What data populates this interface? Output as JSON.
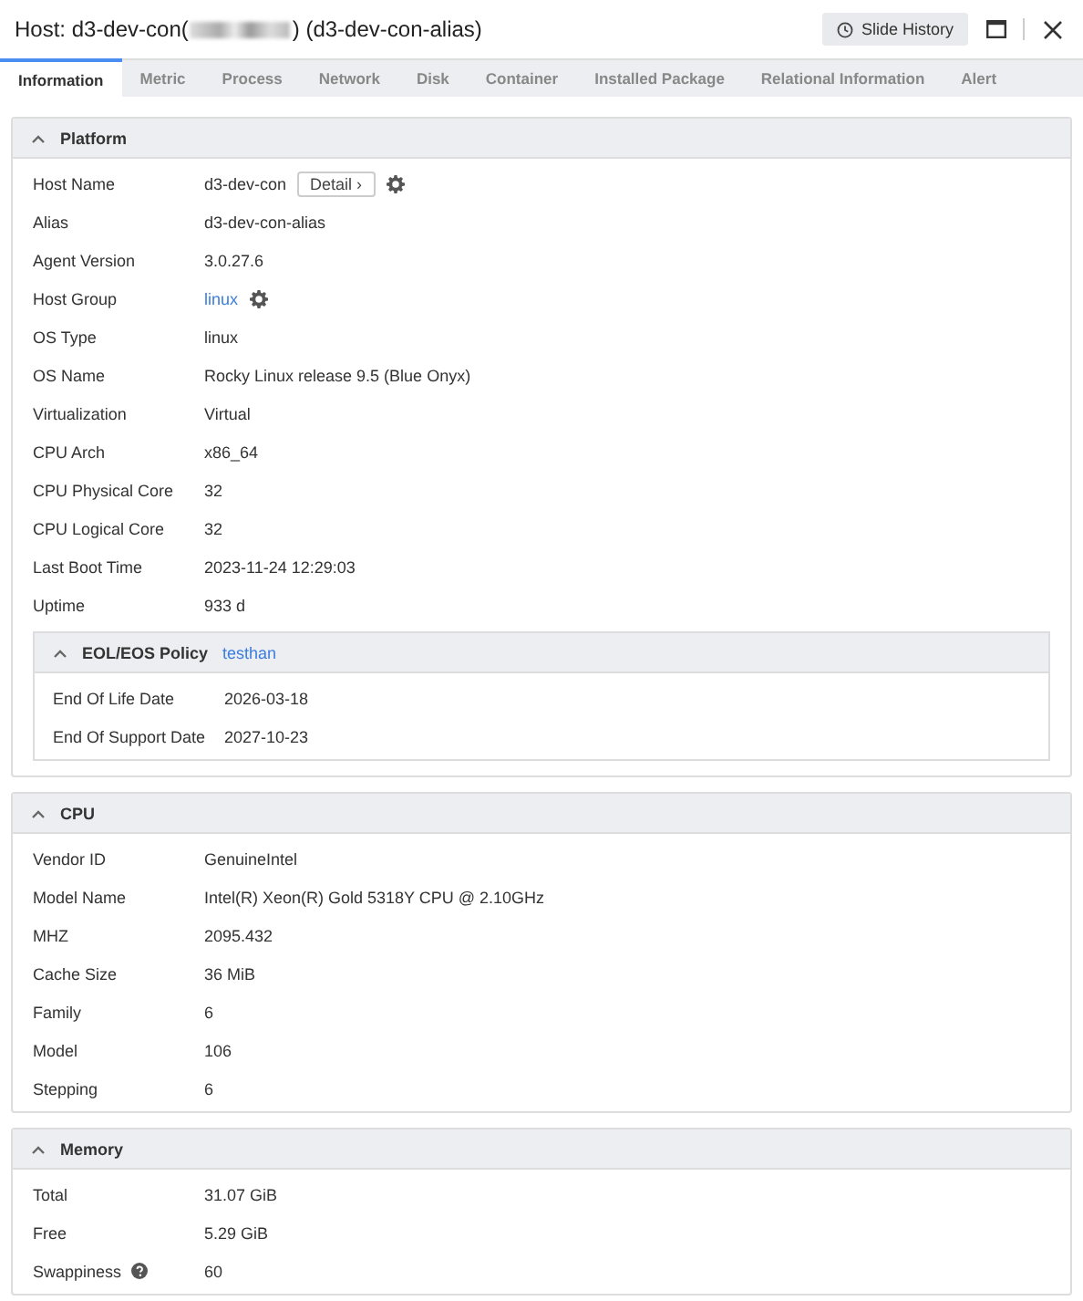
{
  "window": {
    "title_prefix": "Host: d3-dev-con(",
    "title_suffix": ") (d3-dev-con-alias)",
    "history_button": "Slide History"
  },
  "tabs": [
    {
      "label": "Information",
      "selected": true
    },
    {
      "label": "Metric",
      "selected": false
    },
    {
      "label": "Process",
      "selected": false
    },
    {
      "label": "Network",
      "selected": false
    },
    {
      "label": "Disk",
      "selected": false
    },
    {
      "label": "Container",
      "selected": false
    },
    {
      "label": "Installed Package",
      "selected": false
    },
    {
      "label": "Relational Information",
      "selected": false
    },
    {
      "label": "Alert",
      "selected": false
    }
  ],
  "sections": [
    {
      "title": "Platform",
      "expanded": true,
      "rows": [
        {
          "label": "Host Name",
          "value": "d3-dev-con",
          "kind": "text",
          "button": "Detail ›",
          "gear": true
        },
        {
          "label": "Alias",
          "value": "d3-dev-con-alias",
          "kind": "text"
        },
        {
          "label": "Agent Version",
          "value": "3.0.27.6",
          "kind": "text"
        },
        {
          "label": "Host Group",
          "value": "linux",
          "kind": "link",
          "gear": true
        },
        {
          "label": "OS Type",
          "value": "linux",
          "kind": "text"
        },
        {
          "label": "OS Name",
          "value": "Rocky Linux release 9.5 (Blue Onyx)",
          "kind": "text"
        },
        {
          "label": "Virtualization",
          "value": "Virtual",
          "kind": "text"
        },
        {
          "label": "CPU Arch",
          "value": "x86_64",
          "kind": "text"
        },
        {
          "label": "CPU Physical Core",
          "value": "32",
          "kind": "text"
        },
        {
          "label": "CPU Logical Core",
          "value": "32",
          "kind": "text"
        },
        {
          "label": "Last Boot Time",
          "value": "2023-11-24 12:29:03",
          "kind": "text"
        },
        {
          "label": "Uptime",
          "value": "933 d",
          "kind": "text"
        }
      ],
      "subsection": {
        "title": "EOL/EOS Policy",
        "link": "testhan",
        "expanded": true,
        "rows": [
          {
            "label": "End Of Life Date",
            "value": "2026-03-18",
            "kind": "text"
          },
          {
            "label": "End Of Support Date",
            "value": "2027-10-23",
            "kind": "text"
          }
        ]
      }
    },
    {
      "title": "CPU",
      "expanded": true,
      "rows": [
        {
          "label": "Vendor ID",
          "value": "GenuineIntel",
          "kind": "text"
        },
        {
          "label": "Model Name",
          "value": "Intel(R) Xeon(R) Gold 5318Y CPU @ 2.10GHz",
          "kind": "text"
        },
        {
          "label": "MHZ",
          "value": "2095.432",
          "kind": "text"
        },
        {
          "label": "Cache Size",
          "value": "36 MiB",
          "kind": "text"
        },
        {
          "label": "Family",
          "value": "6",
          "kind": "text"
        },
        {
          "label": "Model",
          "value": "106",
          "kind": "text"
        },
        {
          "label": "Stepping",
          "value": "6",
          "kind": "text"
        }
      ]
    },
    {
      "title": "Memory",
      "expanded": true,
      "rows": [
        {
          "label": "Total",
          "value": "31.07 GiB",
          "kind": "text"
        },
        {
          "label": "Free",
          "value": "5.29 GiB",
          "kind": "text"
        },
        {
          "label": "Swappiness",
          "value": "60",
          "kind": "text",
          "help": true
        }
      ]
    }
  ]
}
